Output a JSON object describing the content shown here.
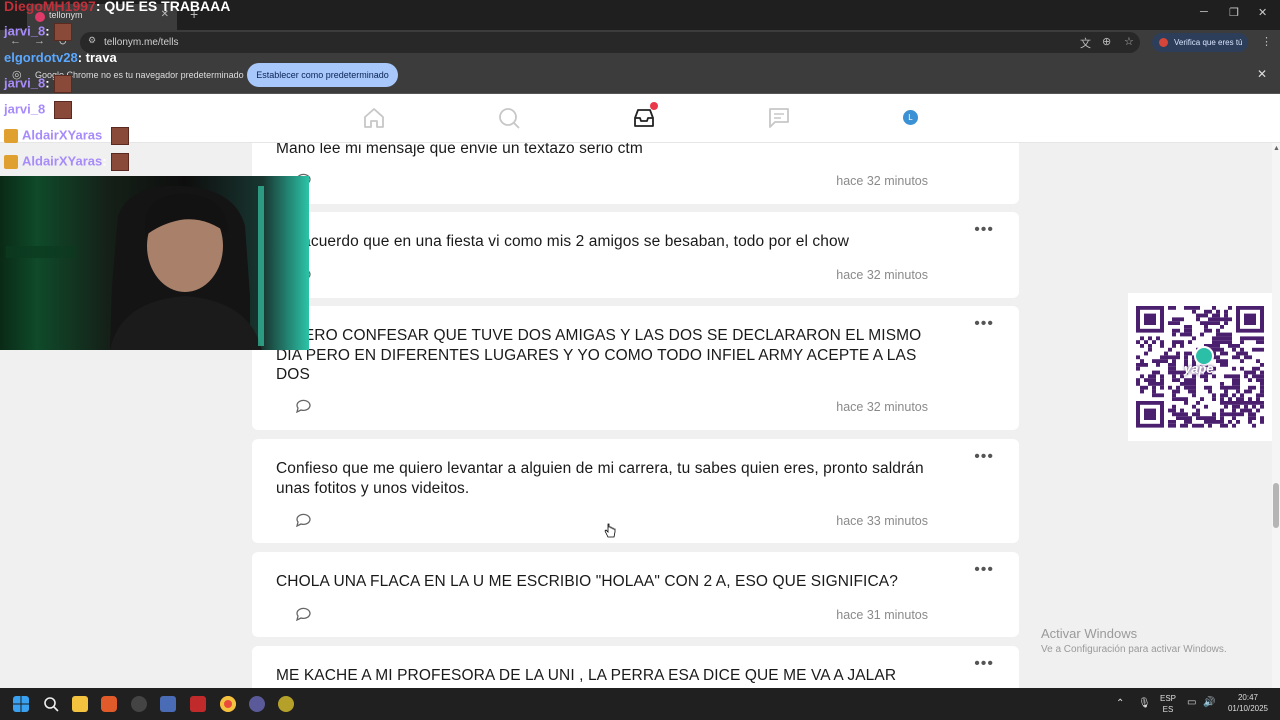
{
  "browser": {
    "tab_title": "tellonym",
    "url": "tellonym.me/tells",
    "verify_label": "Verifica que eres tú",
    "infobar_text": "Google Chrome no es tu navegador predeterminado",
    "infobar_button": "Establecer como predeterminado"
  },
  "site": {
    "avatar_letter": "L"
  },
  "tells": [
    {
      "text": "Mano lee mi mensaje que envie un textazo serio ctm",
      "time": "hace 32 minutos"
    },
    {
      "text": "Me acuerdo que en una fiesta vi como mis 2 amigos se besaban, todo por el chow",
      "time": "hace 32 minutos"
    },
    {
      "text": "QUIERO CONFESAR QUE TUVE DOS AMIGAS Y LAS DOS SE DECLARARON EL MISMO DIA PERO EN DIFERENTES LUGARES Y YO COMO TODO INFIEL ARMY ACEPTE A LAS DOS",
      "time": "hace 32 minutos"
    },
    {
      "text": "Confieso que me quiero levantar a alguien de mi carrera, tu sabes quien eres, pronto saldrán unas fotitos y unos videitos.",
      "time": "hace 33 minutos"
    },
    {
      "text": "CHOLA UNA FLACA EN LA U ME ESCRIBIO \"HOLAA\" CON 2 A, ESO QUE SIGNIFICA?",
      "time": "hace 31 minutos"
    },
    {
      "text": "ME KACHE A MI PROFESORA DE LA UNI , LA PERRA ESA DICE QUE ME VA A JALAR",
      "time": ""
    }
  ],
  "more_label": "•••",
  "chat_overlay": [
    {
      "user": "DiegoMH1997",
      "message": ": QUE ES TRABAAA"
    },
    {
      "user": "jarvi_8",
      "message": ":"
    },
    {
      "user": "elgordotv28",
      "message": ": trava"
    },
    {
      "user": "jarvi_8",
      "message": ":"
    },
    {
      "user": "jarvi_8",
      "message": ":"
    },
    {
      "user": "AldairXYaras",
      "message": ":"
    },
    {
      "user": "AldairXYaras",
      "message": ":"
    }
  ],
  "qr_brand": "yape",
  "watermark": {
    "line1": "Activar Windows",
    "line2": "Ve a Configuración para activar Windows."
  },
  "taskbar": {
    "lang_top": "ESP",
    "lang_bottom": "ES",
    "time": "20:47",
    "date": "01/10/2025"
  },
  "colors": {
    "accent_blue": "#a8c7fa",
    "badge_red": "#e8384a",
    "qr_purple": "#4a1f6e"
  }
}
